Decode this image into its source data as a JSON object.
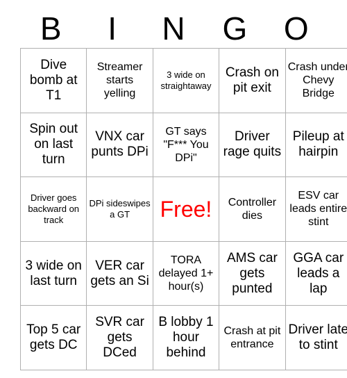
{
  "card": {
    "header_letters": [
      "B",
      "I",
      "N",
      "G",
      "O"
    ],
    "free_space_color": "#ff0000",
    "grid_rows": [
      [
        {
          "text": "Dive bomb at T1",
          "size": "lg"
        },
        {
          "text": "Streamer starts yelling",
          "size": "md"
        },
        {
          "text": "3 wide on straightaway",
          "size": "sm"
        },
        {
          "text": "Crash on pit exit",
          "size": "lg"
        },
        {
          "text": "Crash under Chevy Bridge",
          "size": "md"
        }
      ],
      [
        {
          "text": "Spin out on last turn",
          "size": "lg"
        },
        {
          "text": "VNX car punts DPi",
          "size": "lg"
        },
        {
          "text": "GT says \"F*** You DPi\"",
          "size": "md"
        },
        {
          "text": "Driver rage quits",
          "size": "lg"
        },
        {
          "text": "Pileup at hairpin",
          "size": "lg"
        }
      ],
      [
        {
          "text": "Driver goes backward on track",
          "size": "sm"
        },
        {
          "text": "DPi sideswipes a GT",
          "size": "sm"
        },
        {
          "text": "Free!",
          "size": "xl"
        },
        {
          "text": "Controller dies",
          "size": "md"
        },
        {
          "text": "ESV car leads entire stint",
          "size": "md"
        }
      ],
      [
        {
          "text": "3 wide on last turn",
          "size": "lg"
        },
        {
          "text": "VER car gets an Si",
          "size": "lg"
        },
        {
          "text": "TORA delayed 1+ hour(s)",
          "size": "md"
        },
        {
          "text": "AMS car gets punted",
          "size": "lg"
        },
        {
          "text": "GGA car leads a lap",
          "size": "lg"
        }
      ],
      [
        {
          "text": "Top 5 car gets DC",
          "size": "lg"
        },
        {
          "text": "SVR car gets DCed",
          "size": "lg"
        },
        {
          "text": "B lobby 1 hour behind",
          "size": "lg"
        },
        {
          "text": "Crash at pit entrance",
          "size": "md"
        },
        {
          "text": "Driver late to stint",
          "size": "lg"
        }
      ]
    ]
  }
}
